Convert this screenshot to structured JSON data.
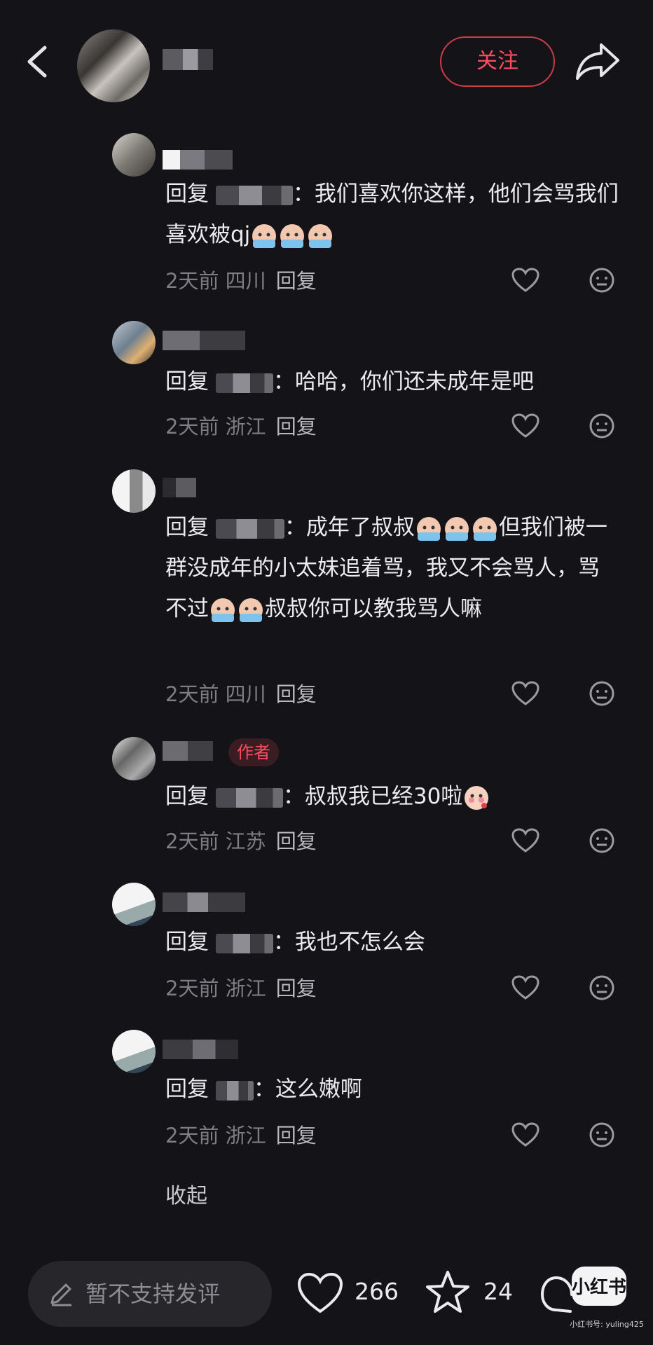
{
  "header": {
    "follow_label": "关注"
  },
  "comments": [
    {
      "reply_prefix": "回复",
      "text": "：我们喜欢你这样，他们会骂我们喜欢被qj",
      "time": "2天前",
      "location": "四川",
      "reply_label": "回复"
    },
    {
      "reply_prefix": "回复",
      "text": "：哈哈，你们还未成年是吧",
      "time": "2天前",
      "location": "浙江",
      "reply_label": "回复"
    },
    {
      "reply_prefix": "回复",
      "text_a": "：成年了叔叔",
      "text_b": "但我们被一群没成年的小太妹追着骂，我又不会骂人，骂不过",
      "text_c": "叔叔你可以教我骂人嘛",
      "time": "2天前",
      "location": "四川",
      "reply_label": "回复"
    },
    {
      "reply_prefix": "回复",
      "badge": "作者",
      "text": "：叔叔我已经30啦",
      "time": "2天前",
      "location": "江苏",
      "reply_label": "回复"
    },
    {
      "reply_prefix": "回复",
      "text": "：我也不怎么会",
      "time": "2天前",
      "location": "浙江",
      "reply_label": "回复"
    },
    {
      "reply_prefix": "回复",
      "text": "：这么嫩啊",
      "time": "2天前",
      "location": "浙江",
      "reply_label": "回复"
    }
  ],
  "collapse_label": "收起",
  "bottom_bar": {
    "input_placeholder": "暂不支持发评",
    "likes": "266",
    "favorites": "24"
  },
  "watermark": {
    "logo": "小红书",
    "text": "小红书号: yuling425"
  }
}
